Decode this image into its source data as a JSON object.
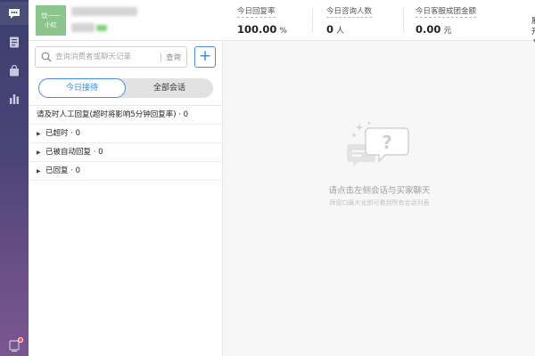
{
  "rail": {
    "items": [
      {
        "icon": "chat-bubble-icon",
        "active": true
      },
      {
        "icon": "document-icon",
        "active": false
      },
      {
        "icon": "shopping-bag-icon",
        "active": false
      },
      {
        "icon": "bar-chart-icon",
        "active": false
      }
    ],
    "bottom_icon": "device-icon"
  },
  "header": {
    "avatar_line1": "饮一一",
    "avatar_line2": "小红",
    "stats": [
      {
        "label": "今日回复率",
        "value": "100.00",
        "unit": "%"
      },
      {
        "label": "今日咨询人数",
        "value": "0",
        "unit": "人"
      },
      {
        "label": "今日客服成团金额",
        "value": "0.00",
        "unit": "元"
      }
    ],
    "expand_label": "展开",
    "expand_caret": "▼"
  },
  "search": {
    "placeholder": "查询消费者或聊天记录",
    "button_label": "查询",
    "add_label": "+"
  },
  "tabs": {
    "active_label": "今日接待",
    "inactive_label": "全部会话"
  },
  "list": {
    "header_row": "请及时人工回复(超时将影响5分钟回复率) · 0",
    "groups": [
      {
        "label": "已超时 · 0"
      },
      {
        "label": "已被自动回复 · 0"
      },
      {
        "label": "已回复 · 0"
      }
    ],
    "caret": "▶"
  },
  "empty_state": {
    "title": "请点击左侧会话与买家聊天",
    "subtitle": "拜窗口最大化即可看到所有会话列表",
    "icon_symbol": "?"
  },
  "colors": {
    "accent": "#3d85d8",
    "rail_top": "#3b3f6e",
    "rail_bottom": "#7b5690",
    "badge": "#ff4a4a",
    "avatar": "#8bc58d"
  }
}
